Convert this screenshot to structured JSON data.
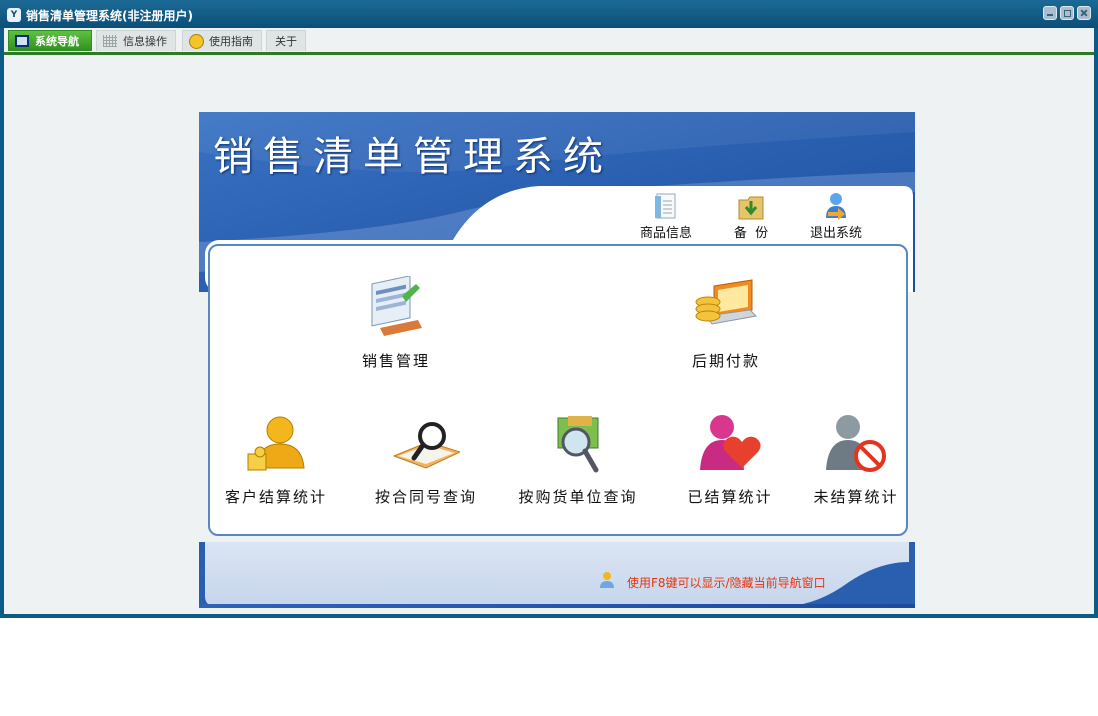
{
  "window": {
    "title": "销售清单管理系统(非注册用户)"
  },
  "tabs": [
    {
      "label": "系统导航",
      "icon": "monitor-icon",
      "active": true
    },
    {
      "label": "信息操作",
      "icon": "grid-icon",
      "active": false
    },
    {
      "label": "使用指南",
      "icon": "smiley-icon",
      "active": false
    },
    {
      "label": "关于",
      "icon": "",
      "active": false
    }
  ],
  "banner": {
    "title": "销售清单管理系统"
  },
  "toolbar": [
    {
      "label": "商品信息",
      "icon": "document-icon"
    },
    {
      "label": "备  份",
      "icon": "backup-folder-icon"
    },
    {
      "label": "退出系统",
      "icon": "exit-user-icon"
    }
  ],
  "menu": {
    "row1": [
      {
        "label": "销售管理",
        "icon": "sales-management-icon"
      },
      {
        "label": "后期付款",
        "icon": "payment-icon"
      }
    ],
    "row2": [
      {
        "label": "客户结算统计",
        "icon": "customer-settlement-icon"
      },
      {
        "label": "按合同号查询",
        "icon": "contract-search-icon"
      },
      {
        "label": "按购货单位查询",
        "icon": "buyer-search-icon"
      },
      {
        "label": "已结算统计",
        "icon": "settled-stats-icon"
      },
      {
        "label": "未结算统计",
        "icon": "unsettled-stats-icon"
      }
    ]
  },
  "hint": "使用F8键可以显示/隐藏当前导航窗口",
  "colors": {
    "titlebar": "#0d5a86",
    "active_tab": "#3aa22a",
    "banner": "#2a5ea8",
    "hint": "#e8330c"
  }
}
